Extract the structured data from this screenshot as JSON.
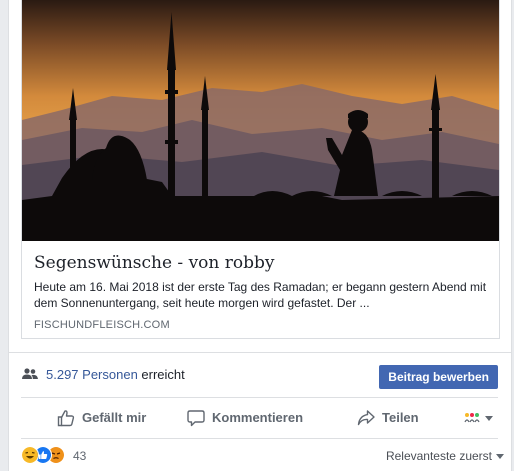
{
  "link_card": {
    "image_icon": "mosque-silhouette-sunset-image",
    "title": "Segenswünsche - von robby",
    "description": "Heute am 16. Mai 2018 ist der erste Tag des Ramadan; er begann gestern Abend mit dem Sonnenuntergang, seit heute morgen wird gefastet. Der ...",
    "domain": "FISCHUNDFLEISCH.COM"
  },
  "reach": {
    "icon": "people-icon",
    "count_text": "5.297 Personen",
    "suffix": "erreicht",
    "boost_label": "Beitrag bewerben"
  },
  "actions": {
    "like_label": "Gefällt mir",
    "comment_label": "Kommentieren",
    "share_label": "Teilen",
    "audience_icon": "audience-selector-icon"
  },
  "footer": {
    "reaction_icons": [
      "haha-icon",
      "like-icon",
      "angry-icon"
    ],
    "reaction_count": "43",
    "sort_label": "Relevanteste zuerst"
  },
  "colors": {
    "link_blue": "#365899",
    "button_blue": "#4267b2",
    "muted_text": "#606770"
  }
}
